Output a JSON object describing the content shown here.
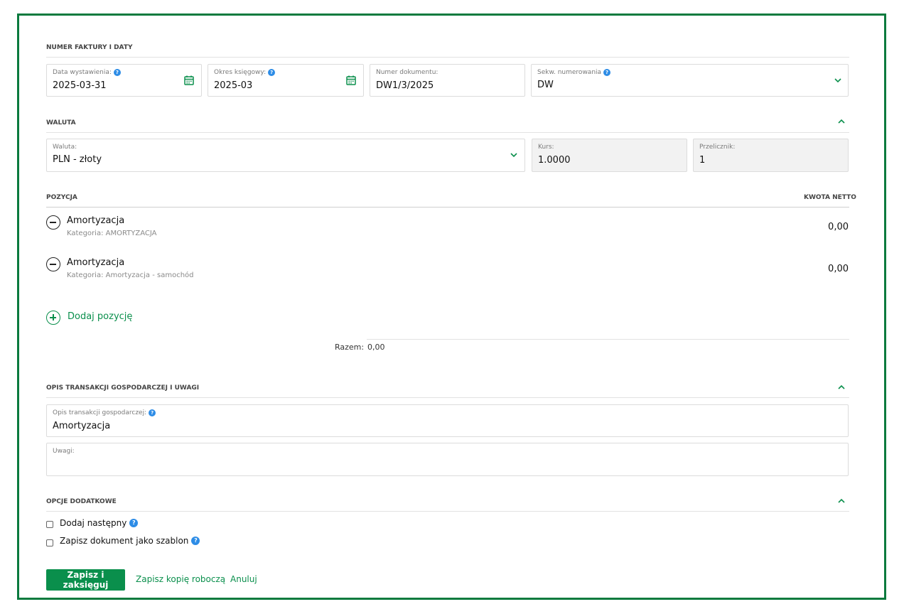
{
  "sections": {
    "invoice": {
      "title": "NUMER FAKTURY I DATY",
      "issue_date": {
        "label": "Data wystawienia:",
        "value": "2025-03-31"
      },
      "period": {
        "label": "Okres księgowy:",
        "value": "2025-03"
      },
      "doc_number": {
        "label": "Numer dokumentu:",
        "value": "DW1/3/2025"
      },
      "sequence": {
        "label": "Sekw. numerowania",
        "value": "DW"
      }
    },
    "currency": {
      "title": "WALUTA",
      "currency": {
        "label": "Waluta:",
        "value": "PLN - złoty"
      },
      "rate": {
        "label": "Kurs:",
        "value": "1.0000"
      },
      "converter": {
        "label": "Przelicznik:",
        "value": "1"
      }
    },
    "positions": {
      "title": "POZYCJA",
      "amount_header": "KWOTA NETTO",
      "items": [
        {
          "name": "Amortyzacja",
          "category": "Kategoria: AMORTYZACJA",
          "amount": "0,00"
        },
        {
          "name": "Amortyzacja",
          "category": "Kategoria: Amortyzacja - samochód",
          "amount": "0,00"
        }
      ],
      "add_label": "Dodaj pozycję",
      "total_label": "Razem:",
      "total_value": "0,00"
    },
    "description": {
      "title": "OPIS TRANSAKCJI GOSPODARCZEJ I UWAGI",
      "transaction": {
        "label": "Opis transakcji gospodarczej:",
        "value": "Amortyzacja"
      },
      "notes": {
        "label": "Uwagi:",
        "value": ""
      }
    },
    "options": {
      "title": "OPCJE DODATKOWE",
      "add_next": "Dodaj następny",
      "save_template": "Zapisz dokument jako szablon"
    }
  },
  "actions": {
    "save_post": "Zapisz i zaksięguj",
    "save_draft": "Zapisz kopię roboczą",
    "cancel": "Anuluj"
  },
  "icons": {
    "calendar": "calendar-icon",
    "chevron_down": "chevron-down-icon",
    "chevron_up": "chevron-up-icon",
    "help": "help-icon",
    "remove": "remove-circle-icon",
    "add": "add-circle-icon"
  },
  "colors": {
    "accent": "#0a8f4c",
    "frame": "#0a7a3e",
    "help": "#2d8ce6"
  }
}
